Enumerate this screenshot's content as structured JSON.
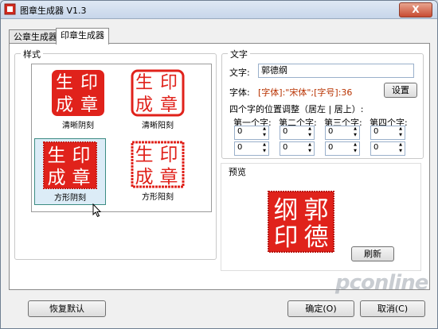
{
  "window": {
    "title": "图章生成器 V1.3",
    "close_label": "X"
  },
  "tabs": [
    {
      "label": "公章生成器"
    },
    {
      "label": "印章生成器"
    }
  ],
  "style_group": {
    "label": "样式",
    "stamp_text": [
      "生",
      "印",
      "成",
      "章"
    ],
    "options": [
      {
        "caption": "清晰阴刻"
      },
      {
        "caption": "清晰阳刻"
      },
      {
        "caption": "方形阴刻"
      },
      {
        "caption": "方形阳刻"
      }
    ],
    "selected": "方形阴刻"
  },
  "text_group": {
    "label": "文字",
    "text_label": "文字:",
    "text_value": "郭德纲",
    "font_label": "字体:",
    "font_desc": "[字体]:\"宋体\";[字号]:36",
    "settings_button": "设置",
    "position_title": "四个字的位置调整（居左 | 居上）:",
    "char_labels": [
      "第一个字:",
      "第二个字:",
      "第三个字:",
      "第四个字:"
    ],
    "row1": [
      "0",
      "0",
      "0",
      "0"
    ],
    "row2": [
      "0",
      "0",
      "0",
      "0"
    ]
  },
  "preview": {
    "label": "预览",
    "chars": [
      "郭",
      "德",
      "纲",
      "印"
    ],
    "refresh_button": "刷新"
  },
  "footer": {
    "reset_button": "恢复默认",
    "ok_button": "确定(O)",
    "cancel_button": "取消(C)"
  },
  "colors": {
    "stamp_red": "#e0221b",
    "font_desc": "#b83200",
    "selected_bg": "#dcecf7"
  }
}
